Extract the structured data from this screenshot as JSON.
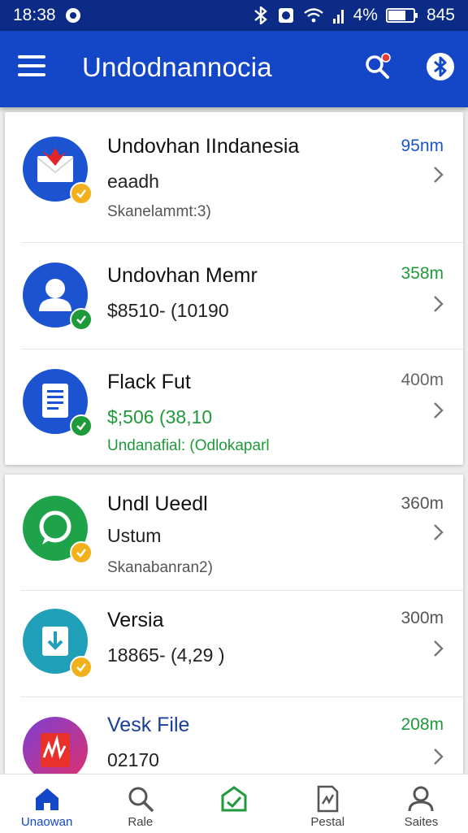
{
  "status_bar": {
    "time": "18:38",
    "battery": "4%",
    "clock_right": "845"
  },
  "app_bar": {
    "title": "Undodnannocia"
  },
  "colors": {
    "primary": "#1447c8",
    "status_bar": "#0b2b86",
    "green": "#1f9a3a",
    "blue_time": "#1a55c9"
  },
  "cards": [
    {
      "items": [
        {
          "title": "Undovhan IIndanesia",
          "line2": "eaadh",
          "line3": "Skanelammt:3)",
          "time": "95nm",
          "icon": "mail-icon"
        },
        {
          "title": "Undovhan Memr",
          "line2": "$8510- (10190",
          "line3": "",
          "time": "358m",
          "icon": "person-icon"
        },
        {
          "title": "Flack Fut",
          "line2": "$;506  (38,10",
          "line3": "Undanafial: (Odlokaparl",
          "time": "400m",
          "icon": "document-icon"
        }
      ]
    },
    {
      "items": [
        {
          "title": "Undl Ueedl",
          "line2": "Ustum",
          "line3": "Skanabanran2)",
          "time": "360m",
          "icon": "chat-icon"
        },
        {
          "title": "Versia",
          "line2": "18865- (4,29       )",
          "line3": "",
          "time": "300m",
          "icon": "download-icon"
        },
        {
          "title": "Vesk File",
          "line2": "02170",
          "line3": "",
          "time": "208m",
          "icon": "chart-icon"
        }
      ]
    }
  ],
  "bottom_nav": [
    {
      "label": "Unaowan",
      "icon": "home-icon"
    },
    {
      "label": "Rale",
      "icon": "search-icon"
    },
    {
      "label": "",
      "icon": "inbox-icon"
    },
    {
      "label": "Pestal",
      "icon": "file-icon"
    },
    {
      "label": "Saites",
      "icon": "profile-icon"
    }
  ]
}
